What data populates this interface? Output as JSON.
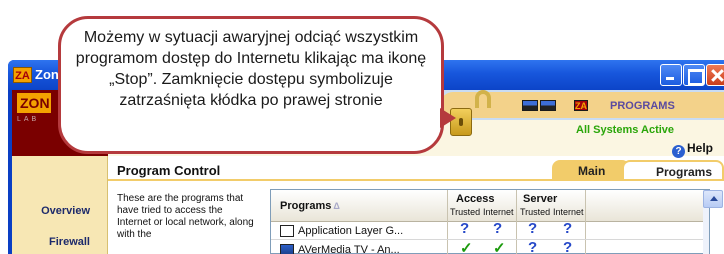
{
  "window": {
    "title": "Zone",
    "app_icon_text": "ZA"
  },
  "header": {
    "logo_text": "ZON",
    "logo_sub": "LAB",
    "programs_label": "PROGRAMS",
    "status": "All Systems Active",
    "help": "Help",
    "toolbar_icon_text": "ZA"
  },
  "tabs": {
    "main": "Main",
    "programs": "Programs"
  },
  "nav": {
    "items": [
      "Overview",
      "Firewall"
    ]
  },
  "panel": {
    "title": "Program Control",
    "description": "These are the programs that have tried to access the Internet or local network, along with the"
  },
  "table": {
    "col_programs": "Programs",
    "sort_mark": "Δ",
    "group_access": "Access",
    "group_server": "Server",
    "sub_cols": [
      "Trusted",
      "Internet",
      "Trusted",
      "Internet"
    ],
    "rows": [
      {
        "name": "Application Layer G...",
        "cells": [
          "?",
          "?",
          "?",
          "?"
        ]
      },
      {
        "name": "AVerMedia TV - An...",
        "cells": [
          "✓",
          "✓",
          "?",
          "?"
        ]
      }
    ]
  },
  "callout": {
    "text": "Możemy w sytuacji awaryjnej odciąć wszystkim programom dostęp do Internetu klikając ma ikonę „Stop”. Zamknięcie dostępu symbolizuje zatrzaśnięta kłódka po prawej stronie"
  },
  "colors": {
    "titlebar": "#1756dc",
    "callout_border": "#b53a3d",
    "status_green": "#2aa60a",
    "question_blue": "#2548c8"
  }
}
